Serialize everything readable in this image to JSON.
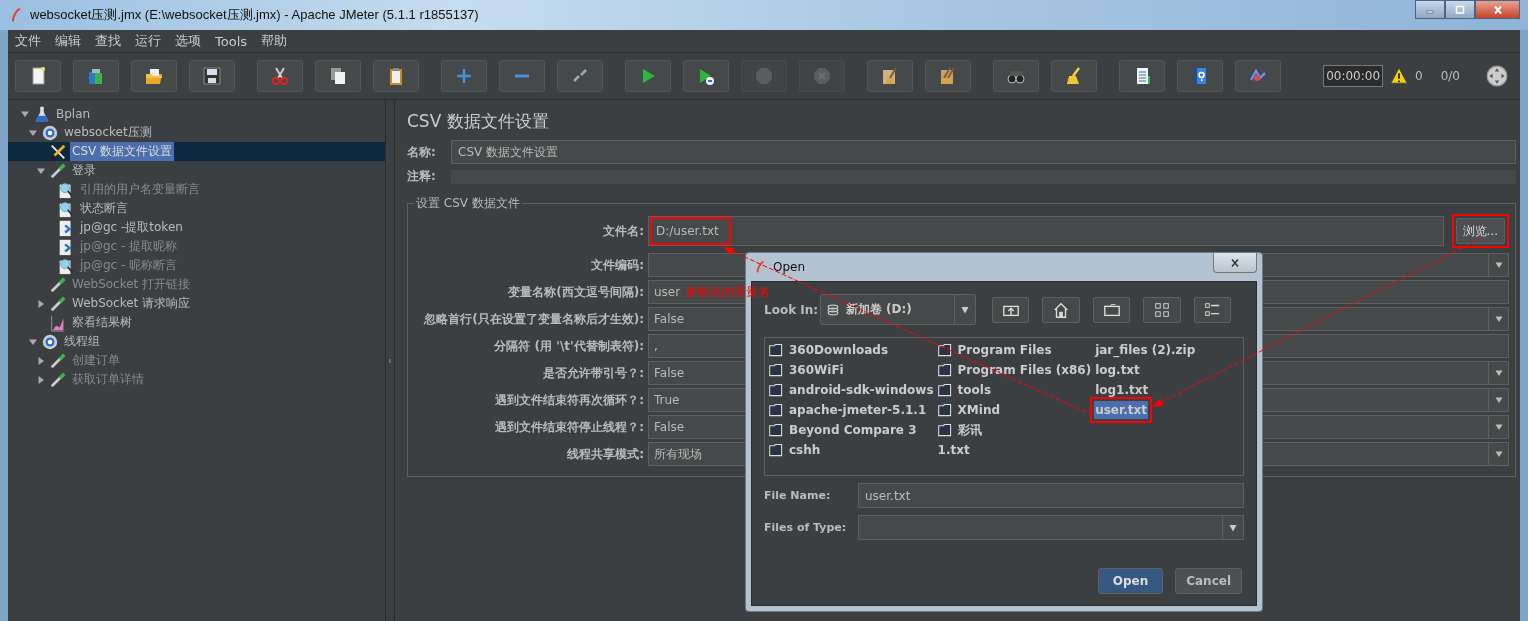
{
  "window": {
    "title": "websocket压测.jmx (E:\\websocket压测.jmx) - Apache JMeter (5.1.1 r1855137)"
  },
  "menu": [
    "文件",
    "编辑",
    "查找",
    "运行",
    "选项",
    "Tools",
    "帮助"
  ],
  "toolbar": [
    {
      "disabled": false
    },
    {
      "disabled": false
    },
    {
      "disabled": false
    },
    {
      "disabled": false
    },
    {
      "disabled": false
    },
    {
      "disabled": false
    },
    {
      "disabled": false
    },
    {
      "disabled": false
    },
    {
      "disabled": false
    },
    {
      "disabled": false
    },
    {
      "disabled": false
    },
    {
      "disabled": false
    },
    {
      "disabled": true
    },
    {
      "disabled": true
    },
    {
      "disabled": false
    },
    {
      "disabled": false
    },
    {
      "disabled": false
    },
    {
      "disabled": false
    },
    {
      "disabled": false
    },
    {
      "disabled": false
    },
    {
      "disabled": false
    }
  ],
  "status": {
    "timer": "00:00:00",
    "warnings": "0",
    "threads": "0/0"
  },
  "tree": [
    {
      "label": "Bplan",
      "kind": "plan",
      "expanded": true,
      "selected": false,
      "disabled": false,
      "children": [
        {
          "label": "websocket压测",
          "kind": "group",
          "expanded": true,
          "selected": false,
          "disabled": false,
          "children": [
            {
              "label": "CSV 数据文件设置",
              "kind": "config",
              "selected": true,
              "disabled": false
            },
            {
              "label": "登录",
              "kind": "sampler",
              "expanded": true,
              "selected": false,
              "disabled": false,
              "children": [
                {
                  "label": "引用的用户名变量断言",
                  "kind": "assertion",
                  "selected": false,
                  "disabled": true
                },
                {
                  "label": "状态断言",
                  "kind": "assertion",
                  "selected": false,
                  "disabled": false
                },
                {
                  "label": "jp@gc -提取token",
                  "kind": "extractor",
                  "selected": false,
                  "disabled": false
                },
                {
                  "label": "jp@gc - 提取昵称",
                  "kind": "extractor",
                  "selected": false,
                  "disabled": true
                },
                {
                  "label": "jp@gc - 昵称断言",
                  "kind": "assertion",
                  "selected": false,
                  "disabled": true
                }
              ]
            },
            {
              "label": "WebSocket 打开链接",
              "kind": "sampler",
              "selected": false,
              "disabled": true
            },
            {
              "label": "WebSocket 请求响应",
              "kind": "sampler",
              "expanded": false,
              "selected": false,
              "disabled": false
            },
            {
              "label": "察看结果树",
              "kind": "listener",
              "selected": false,
              "disabled": false
            }
          ]
        },
        {
          "label": "线程组",
          "kind": "group",
          "expanded": true,
          "selected": false,
          "disabled": false,
          "children": [
            {
              "label": "创建订单",
              "kind": "sampler",
              "expanded": false,
              "selected": false,
              "disabled": true
            },
            {
              "label": "获取订单详情",
              "kind": "sampler",
              "expanded": false,
              "selected": false,
              "disabled": true
            }
          ]
        }
      ]
    }
  ],
  "editor": {
    "title": "CSV 数据文件设置",
    "name_label": "名称:",
    "name": "CSV 数据文件设置",
    "comment_label": "注释:",
    "group_title": "设置 CSV 数据文件",
    "browse": {
      "label": "浏览...",
      "highlighted": true
    },
    "fields": [
      {
        "label": "文件名:",
        "kind": "text",
        "value": "D:/user.txt",
        "highlighted": true
      },
      {
        "label": "文件编码:",
        "kind": "combo",
        "highlighted": false
      },
      {
        "label": "变量名称(西文逗号间隔):",
        "kind": "text",
        "value": "user",
        "note": "参数化的变量名",
        "highlighted": false
      },
      {
        "label": "忽略首行(只在设置了变量名称后才生效):",
        "kind": "combo",
        "value": "False",
        "highlighted": false
      },
      {
        "label": "分隔符 (用 '\\t'代替制表符):",
        "kind": "text",
        "value": ",",
        "highlighted": false
      },
      {
        "label": "是否允许带引号？:",
        "kind": "combo",
        "value": "False",
        "highlighted": false
      },
      {
        "label": "遇到文件结束符再次循环？:",
        "kind": "combo",
        "value": "True",
        "highlighted": false
      },
      {
        "label": "遇到文件结束符停止线程？:",
        "kind": "combo",
        "value": "False",
        "highlighted": false
      },
      {
        "label": "线程共享模式:",
        "kind": "combo",
        "value": "所有现场",
        "highlighted": false
      }
    ]
  },
  "dialog": {
    "title": "Open",
    "look_in_label": "Look In:",
    "look_in": "新加卷 (D:)",
    "files": [
      {
        "name": "360Downloads",
        "kind": "folder",
        "selected": false,
        "highlighted": false
      },
      {
        "name": "360WiFi",
        "kind": "folder",
        "selected": false,
        "highlighted": false
      },
      {
        "name": "android-sdk-windows",
        "kind": "folder",
        "selected": false,
        "highlighted": false
      },
      {
        "name": "apache-jmeter-5.1.1",
        "kind": "folder",
        "selected": false,
        "highlighted": false
      },
      {
        "name": "Beyond Compare 3",
        "kind": "folder",
        "selected": false,
        "highlighted": false
      },
      {
        "name": "cshh",
        "kind": "folder",
        "selected": false,
        "highlighted": false
      },
      {
        "name": "Program Files",
        "kind": "folder",
        "selected": false,
        "highlighted": false
      },
      {
        "name": "Program Files (x86)",
        "kind": "folder",
        "selected": false,
        "highlighted": false
      },
      {
        "name": "tools",
        "kind": "folder",
        "selected": false,
        "highlighted": false
      },
      {
        "name": "XMind",
        "kind": "folder",
        "selected": false,
        "highlighted": false
      },
      {
        "name": "彩讯",
        "kind": "folder",
        "selected": false,
        "highlighted": false
      },
      {
        "name": "1.txt",
        "kind": "file",
        "selected": false,
        "highlighted": false
      },
      {
        "name": "jar_files (2).zip",
        "kind": "file",
        "selected": false,
        "highlighted": false
      },
      {
        "name": "log.txt",
        "kind": "file",
        "selected": false,
        "highlighted": false
      },
      {
        "name": "log1.txt",
        "kind": "file",
        "selected": false,
        "highlighted": false
      },
      {
        "name": "user.txt",
        "kind": "file",
        "selected": true,
        "highlighted": true
      }
    ],
    "file_name_label": "File Name:",
    "file_name": "user.txt",
    "file_type_label": "Files of Type:",
    "buttons": [
      {
        "label": "Open",
        "default": true
      },
      {
        "label": "Cancel",
        "default": false
      }
    ]
  }
}
